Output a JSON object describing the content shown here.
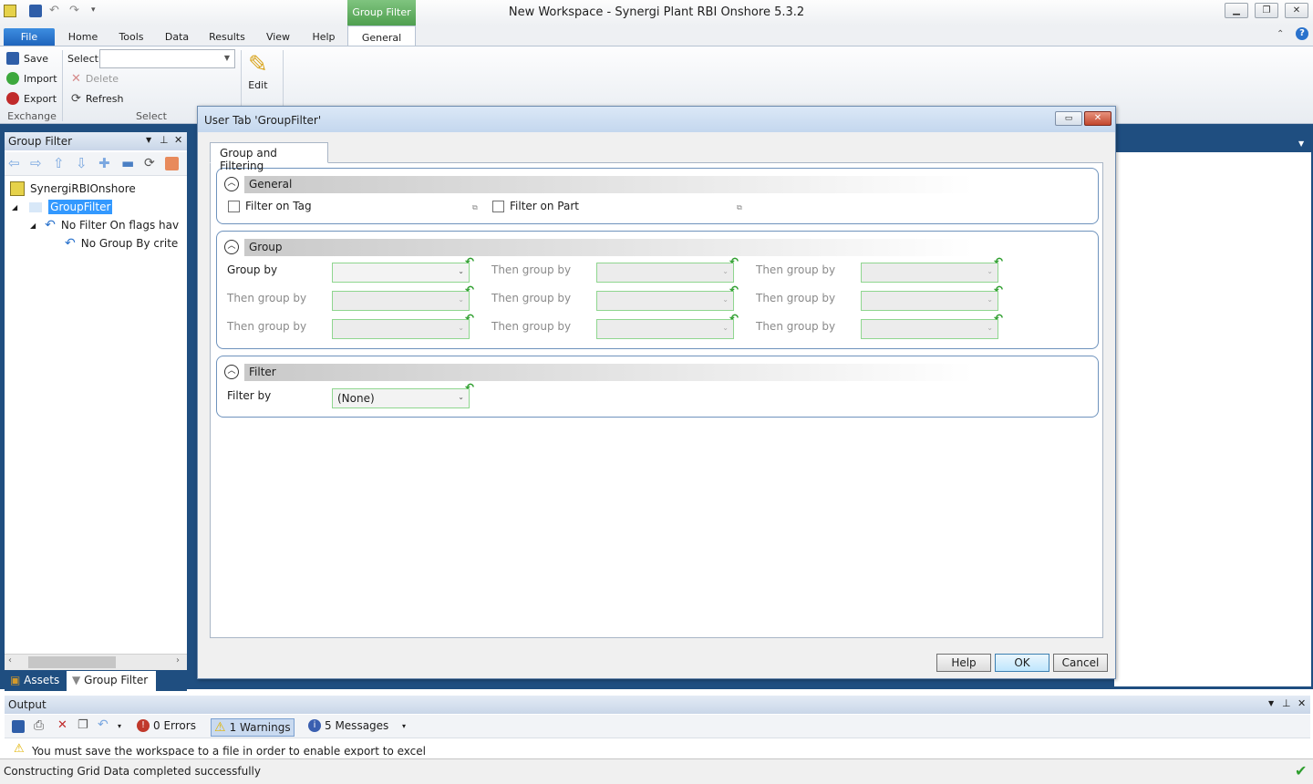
{
  "window": {
    "title": "New Workspace - Synergi Plant RBI Onshore 5.3.2",
    "context_tab_group": "Group Filter"
  },
  "ribbon": {
    "tabs": [
      "File",
      "Home",
      "Tools",
      "Data",
      "Results",
      "View",
      "Help",
      "General"
    ],
    "exchange": {
      "save": "Save",
      "import": "Import",
      "export": "Export",
      "group_label": "Exchange"
    },
    "select": {
      "label": "Select",
      "value": "",
      "delete": "Delete",
      "refresh": "Refresh",
      "group_label": "Select"
    },
    "edit": {
      "label": "Edit"
    }
  },
  "left_panel": {
    "title": "Group Filter",
    "tree": {
      "root": "SynergiRBIOnshore",
      "group_filter": "GroupFilter",
      "no_filter": "No Filter On flags hav",
      "no_group": "No Group By crite"
    },
    "bottom_tabs": [
      "Assets",
      "Group Filter"
    ]
  },
  "dialog": {
    "title": "User Tab 'GroupFilter'",
    "tab": "Group and Filtering",
    "general": {
      "header": "General",
      "filter_on_tag": "Filter on Tag",
      "filter_on_part": "Filter on Part",
      "filter_on_tag_checked": false,
      "filter_on_part_checked": false
    },
    "group": {
      "header": "Group",
      "labels": [
        [
          "Group by",
          "Then group by",
          "Then group by"
        ],
        [
          "Then group by",
          "Then group by",
          "Then group by"
        ],
        [
          "Then group by",
          "Then group by",
          "Then group by"
        ]
      ]
    },
    "filter": {
      "header": "Filter",
      "label": "Filter by",
      "value": "(None)"
    },
    "buttons": {
      "help": "Help",
      "ok": "OK",
      "cancel": "Cancel"
    }
  },
  "output": {
    "title": "Output",
    "errors": "0 Errors",
    "warnings": "1 Warnings",
    "messages": "5 Messages",
    "first_line": "You must save the workspace to a file in order to enable export to excel"
  },
  "status": {
    "text": "Constructing Grid Data completed successfully"
  },
  "colors": {
    "accent_blue": "#1f4e80",
    "file_tab": "#2a72cc",
    "context_green": "#5fae5f",
    "section_border": "#6f93bd"
  }
}
